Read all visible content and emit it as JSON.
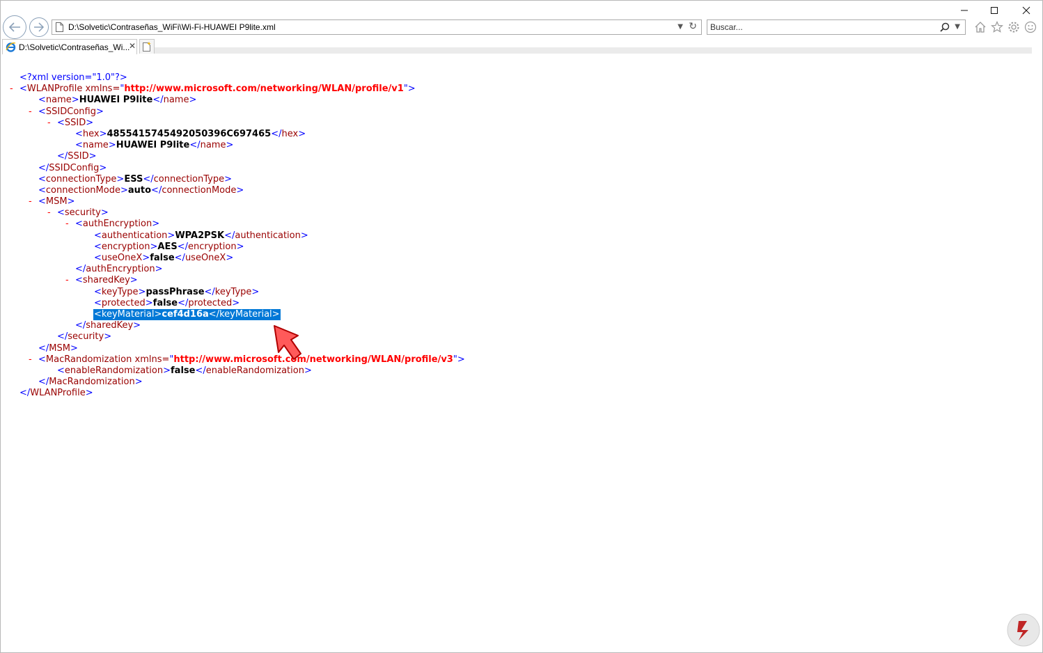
{
  "address_bar": {
    "url": "D:\\Solvetic\\Contraseñas_WiFi\\Wi-Fi-HUAWEI P9lite.xml"
  },
  "search": {
    "placeholder": "Buscar..."
  },
  "tab": {
    "title": "D:\\Solvetic\\Contraseñas_Wi..."
  },
  "icons": [
    "back-arrow-icon",
    "forward-arrow-icon",
    "page-icon",
    "refresh-icon",
    "search-icon",
    "home-icon",
    "favorites-star-icon",
    "settings-gear-icon",
    "smiley-feedback-icon",
    "minimize-icon",
    "maximize-icon",
    "close-icon",
    "ie-icon",
    "new-tab-icon",
    "red-pointer-arrow-icon",
    "solvetic-logo-icon"
  ],
  "xml": {
    "declaration": "<?xml version=\"1.0\"?>",
    "wlan_tag": "WLANProfile",
    "xmlns_attr": " xmlns=",
    "wlan_ns": "http://www.microsoft.com/networking/WLAN/profile/v1",
    "name_tag": "name",
    "profile_name": "HUAWEI P9lite",
    "ssidconfig_tag": "SSIDConfig",
    "ssid_tag": "SSID",
    "hex_tag": "hex",
    "ssid_hex": "4855415745492050396C697465",
    "ssid_name": "HUAWEI P9lite",
    "conntype_tag": "connectionType",
    "conntype_value": "ESS",
    "connmode_tag": "connectionMode",
    "connmode_value": "auto",
    "msm_tag": "MSM",
    "security_tag": "security",
    "authenc_tag": "authEncryption",
    "auth_tag": "authentication",
    "auth_value": "WPA2PSK",
    "enc_tag": "encryption",
    "enc_value": "AES",
    "useonex_tag": "useOneX",
    "useonex_value": "false",
    "sharedkey_tag": "sharedKey",
    "keytype_tag": "keyType",
    "keytype_value": "passPhrase",
    "protected_tag": "protected",
    "protected_value": "false",
    "keymaterial_tag": "keyMaterial",
    "keymaterial_value": "cef4d16a",
    "macrand_tag": "MacRandomization",
    "macrand_ns": "http://www.microsoft.com/networking/WLAN/profile/v3",
    "enablerand_tag": "enableRandomization",
    "enablerand_value": "false",
    "collapse_symbol": "-"
  }
}
